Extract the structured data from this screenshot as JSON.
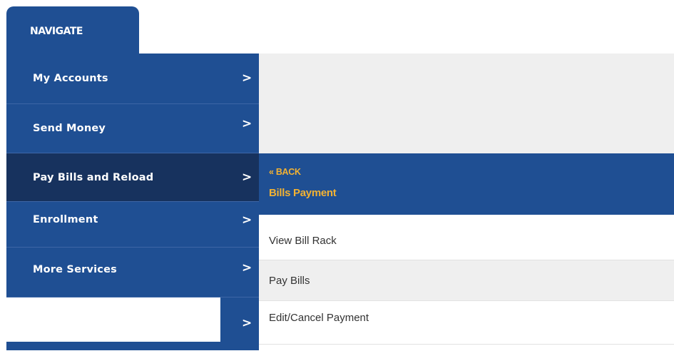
{
  "nav_tab": {
    "label": "NAVIGATE"
  },
  "menu": {
    "items": [
      {
        "label": "My Accounts",
        "chevron": ">"
      },
      {
        "label": "Send Money",
        "chevron": ">"
      },
      {
        "label": "Pay Bills and Reload",
        "chevron": ">",
        "active": true
      },
      {
        "label": "Enrollment",
        "chevron": ">"
      },
      {
        "label": "More Services",
        "chevron": ">"
      }
    ],
    "blank_chevron": ">"
  },
  "submenu": {
    "back_label": "« BACK",
    "title": "Bills Payment",
    "items": [
      {
        "label": "View Bill Rack"
      },
      {
        "label": "Pay Bills"
      },
      {
        "label": "Edit/Cancel Payment"
      }
    ]
  },
  "colors": {
    "nav_blue": "#1f4f93",
    "active_blue": "#17325e",
    "accent_gold": "#f2b233",
    "panel_gray": "#efefef"
  },
  "icons": {
    "chevron": "chevron-right-icon",
    "back": "double-chevron-left-icon"
  }
}
